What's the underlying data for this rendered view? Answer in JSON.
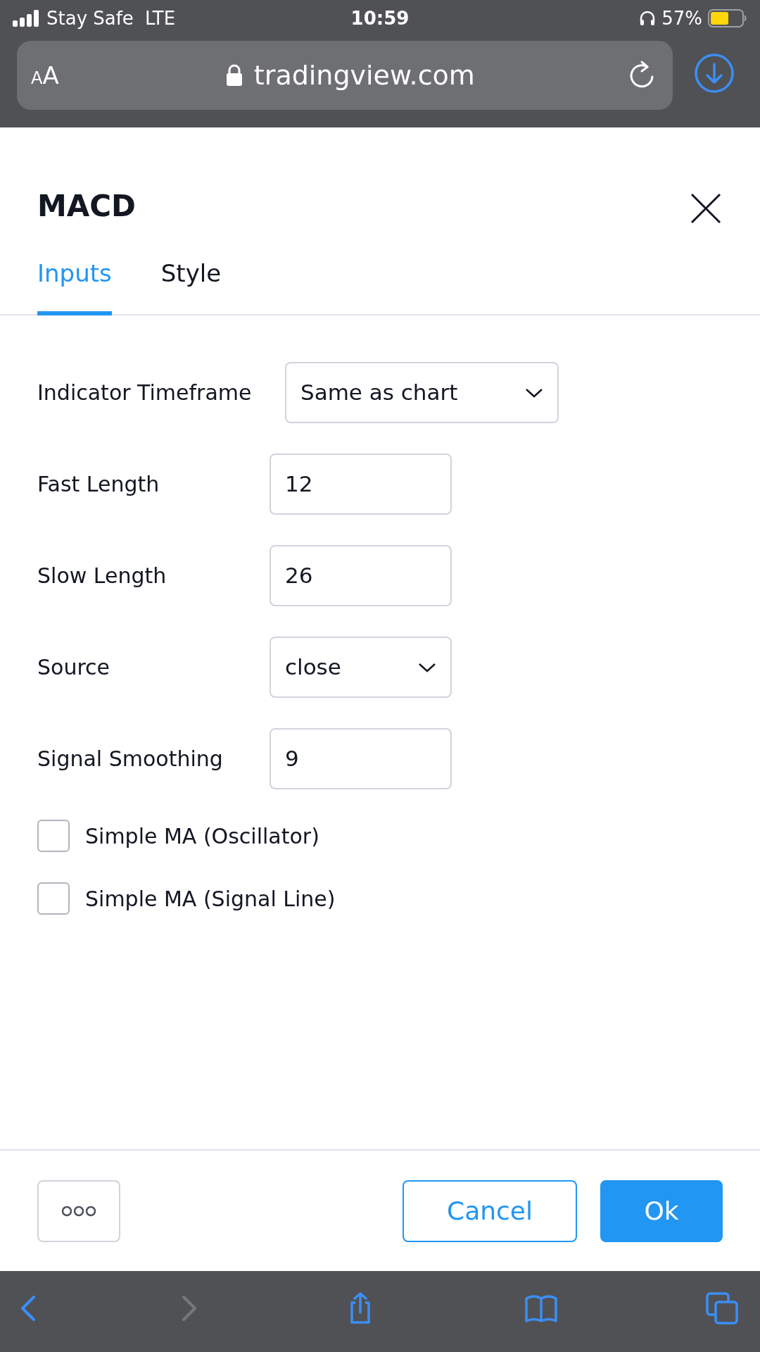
{
  "status_bar": {
    "carrier": "Stay Safe",
    "network": "LTE",
    "time": "10:59",
    "battery": "57%"
  },
  "browser": {
    "text_size": "AA",
    "url": "tradingview.com"
  },
  "dialog": {
    "title": "MACD",
    "tabs": [
      {
        "label": "Inputs",
        "selected": true
      },
      {
        "label": "Style",
        "selected": false
      }
    ],
    "fields": [
      {
        "kind": "select",
        "label": "Indicator Timeframe",
        "value": "Same as chart"
      },
      {
        "kind": "number",
        "label": "Fast Length",
        "value": "12"
      },
      {
        "kind": "number",
        "label": "Slow Length",
        "value": "26"
      },
      {
        "kind": "select",
        "label": "Source",
        "value": "close"
      },
      {
        "kind": "number",
        "label": "Signal Smoothing",
        "value": "9"
      }
    ],
    "checkboxes": [
      {
        "label": "Simple MA (Oscillator)",
        "checked": false
      },
      {
        "label": "Simple MA (Signal Line)",
        "checked": false
      }
    ],
    "buttons": {
      "cancel": "Cancel",
      "ok": "Ok"
    }
  },
  "toolbar": [
    {
      "kind": "back",
      "disabled": false
    },
    {
      "kind": "forward",
      "disabled": true
    },
    {
      "kind": "share",
      "disabled": false
    },
    {
      "kind": "bookmarks",
      "disabled": false
    },
    {
      "kind": "tabs",
      "disabled": false
    }
  ]
}
